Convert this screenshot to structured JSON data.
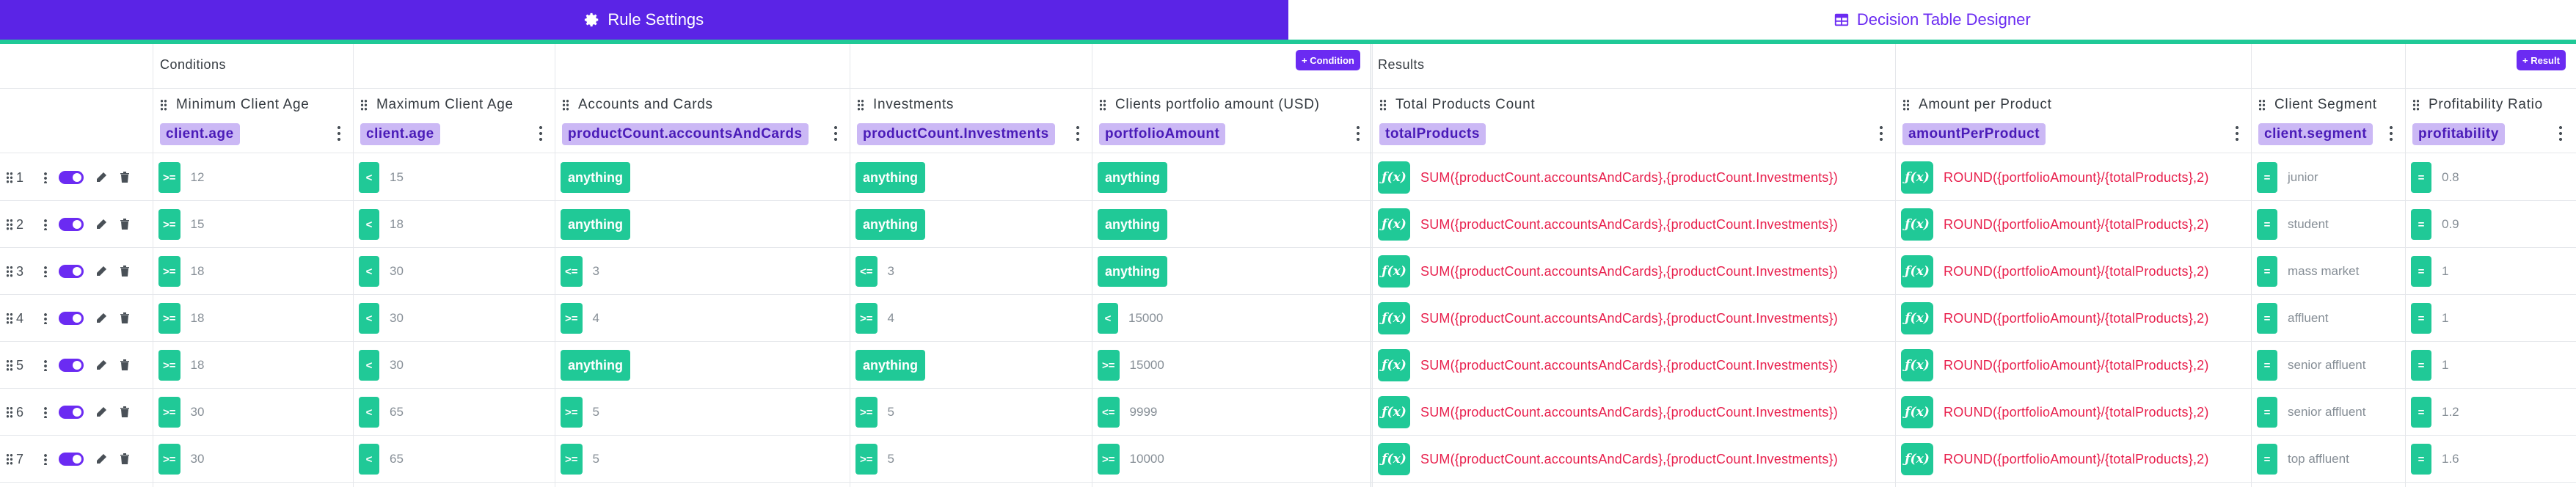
{
  "tabs": [
    {
      "label": "Rule Settings",
      "icon": "gear-icon"
    },
    {
      "label": "Decision Table Designer",
      "icon": "table-icon"
    }
  ],
  "sections": {
    "conditions": "Conditions",
    "results": "Results",
    "add_condition": "+ Condition",
    "add_result": "+ Result"
  },
  "columns": [
    {
      "header": "Minimum Client Age",
      "field": "client.age"
    },
    {
      "header": "Maximum Client Age",
      "field": "client.age"
    },
    {
      "header": "Accounts and Cards",
      "field": "productCount.accountsAndCards"
    },
    {
      "header": "Investments",
      "field": "productCount.Investments"
    },
    {
      "header": "Clients portfolio amount (USD)",
      "field": "portfolioAmount"
    },
    {
      "header": "Total Products Count",
      "field": "totalProducts"
    },
    {
      "header": "Amount per Product",
      "field": "amountPerProduct"
    },
    {
      "header": "Client Segment",
      "field": "client.segment"
    },
    {
      "header": "Profitability Ratio",
      "field": "profitability"
    }
  ],
  "formulas": {
    "total": "SUM({productCount.accountsAndCards},{productCount.Investments})",
    "amount": "ROUND({portfolioAmount}/{totalProducts},2)"
  },
  "rows": [
    {
      "n": "1",
      "minOp": ">=",
      "min": "12",
      "maxOp": "<",
      "max": "15",
      "acc": {
        "any": "anything"
      },
      "inv": {
        "any": "anything"
      },
      "port": {
        "any": "anything"
      },
      "segOp": "=",
      "seg": "junior",
      "profOp": "=",
      "prof": "0.8"
    },
    {
      "n": "2",
      "minOp": ">=",
      "min": "15",
      "maxOp": "<",
      "max": "18",
      "acc": {
        "any": "anything"
      },
      "inv": {
        "any": "anything"
      },
      "port": {
        "any": "anything"
      },
      "segOp": "=",
      "seg": "student",
      "profOp": "=",
      "prof": "0.9"
    },
    {
      "n": "3",
      "minOp": ">=",
      "min": "18",
      "maxOp": "<",
      "max": "30",
      "acc": {
        "op": "<=",
        "v": "3"
      },
      "inv": {
        "op": "<=",
        "v": "3"
      },
      "port": {
        "any": "anything"
      },
      "segOp": "=",
      "seg": "mass market",
      "profOp": "=",
      "prof": "1"
    },
    {
      "n": "4",
      "minOp": ">=",
      "min": "18",
      "maxOp": "<",
      "max": "30",
      "acc": {
        "op": ">=",
        "v": "4"
      },
      "inv": {
        "op": ">=",
        "v": "4"
      },
      "port": {
        "op": "<",
        "v": "15000"
      },
      "segOp": "=",
      "seg": "affluent",
      "profOp": "=",
      "prof": "1"
    },
    {
      "n": "5",
      "minOp": ">=",
      "min": "18",
      "maxOp": "<",
      "max": "30",
      "acc": {
        "any": "anything"
      },
      "inv": {
        "any": "anything"
      },
      "port": {
        "op": ">=",
        "v": "15000"
      },
      "segOp": "=",
      "seg": "senior affluent",
      "profOp": "=",
      "prof": "1"
    },
    {
      "n": "6",
      "minOp": ">=",
      "min": "30",
      "maxOp": "<",
      "max": "65",
      "acc": {
        "op": ">=",
        "v": "5"
      },
      "inv": {
        "op": ">=",
        "v": "5"
      },
      "port": {
        "op": "<=",
        "v": "9999"
      },
      "segOp": "=",
      "seg": "senior affluent",
      "profOp": "=",
      "prof": "1.2"
    },
    {
      "n": "7",
      "minOp": ">=",
      "min": "30",
      "maxOp": "<",
      "max": "65",
      "acc": {
        "op": ">=",
        "v": "5"
      },
      "inv": {
        "op": ">=",
        "v": "5"
      },
      "port": {
        "op": ">=",
        "v": "10000"
      },
      "segOp": "=",
      "seg": "top affluent",
      "profOp": "=",
      "prof": "1.6"
    }
  ],
  "colors": {
    "primary": "#6b2bf2",
    "accent": "#20c997",
    "formula": "#e8204d"
  }
}
